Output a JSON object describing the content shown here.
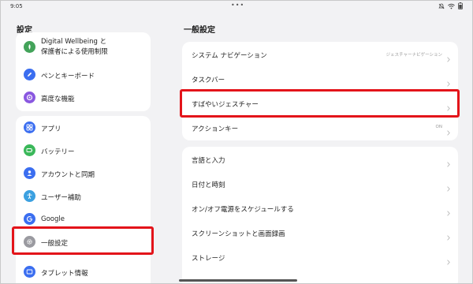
{
  "status_bar": {
    "time": "9:05",
    "dots": "•••"
  },
  "left": {
    "title": "設定",
    "group1": [
      {
        "label": "Digital Wellbeing と\n保護者による使用制限",
        "icon": "digital-wellbeing-icon",
        "color": "#43a35a"
      },
      {
        "label": "ペンとキーボード",
        "icon": "pen-icon",
        "color": "#3b6ef0"
      },
      {
        "label": "高度な機能",
        "icon": "advanced-icon",
        "color": "#8a58e0"
      }
    ],
    "group2": [
      {
        "label": "アプリ",
        "icon": "apps-icon",
        "color": "#3b6ef0"
      },
      {
        "label": "バッテリー",
        "icon": "battery-icon",
        "color": "#3bb85a"
      },
      {
        "label": "アカウントと同期",
        "icon": "account-icon",
        "color": "#3b6ef0"
      },
      {
        "label": "ユーザー補助",
        "icon": "accessibility-icon",
        "color": "#3ba0e0"
      },
      {
        "label": "Google",
        "icon": "google-icon",
        "color": "#3b6ef0"
      },
      {
        "label": "一般設定",
        "icon": "gear-icon",
        "color": "#9a9aa0"
      },
      {
        "label": "タブレット情報",
        "icon": "tablet-icon",
        "color": "#3b6ef0"
      }
    ]
  },
  "right": {
    "title": "一般設定",
    "group1": [
      {
        "label": "システム ナビゲーション",
        "value": "ジェスチャーナビゲーション"
      },
      {
        "label": "タスクバー",
        "value": ""
      },
      {
        "label": "すばやいジェスチャー",
        "value": ""
      },
      {
        "label": "アクションキー",
        "value": "ON"
      }
    ],
    "group2": [
      {
        "label": "言語と入力",
        "value": ""
      },
      {
        "label": "日付と時刻",
        "value": ""
      },
      {
        "label": "オン/オフ電源をスケジュールする",
        "value": ""
      },
      {
        "label": "スクリーンショットと画面録画",
        "value": ""
      },
      {
        "label": "ストレージ",
        "value": ""
      }
    ]
  },
  "highlight_color": "#e3141a"
}
